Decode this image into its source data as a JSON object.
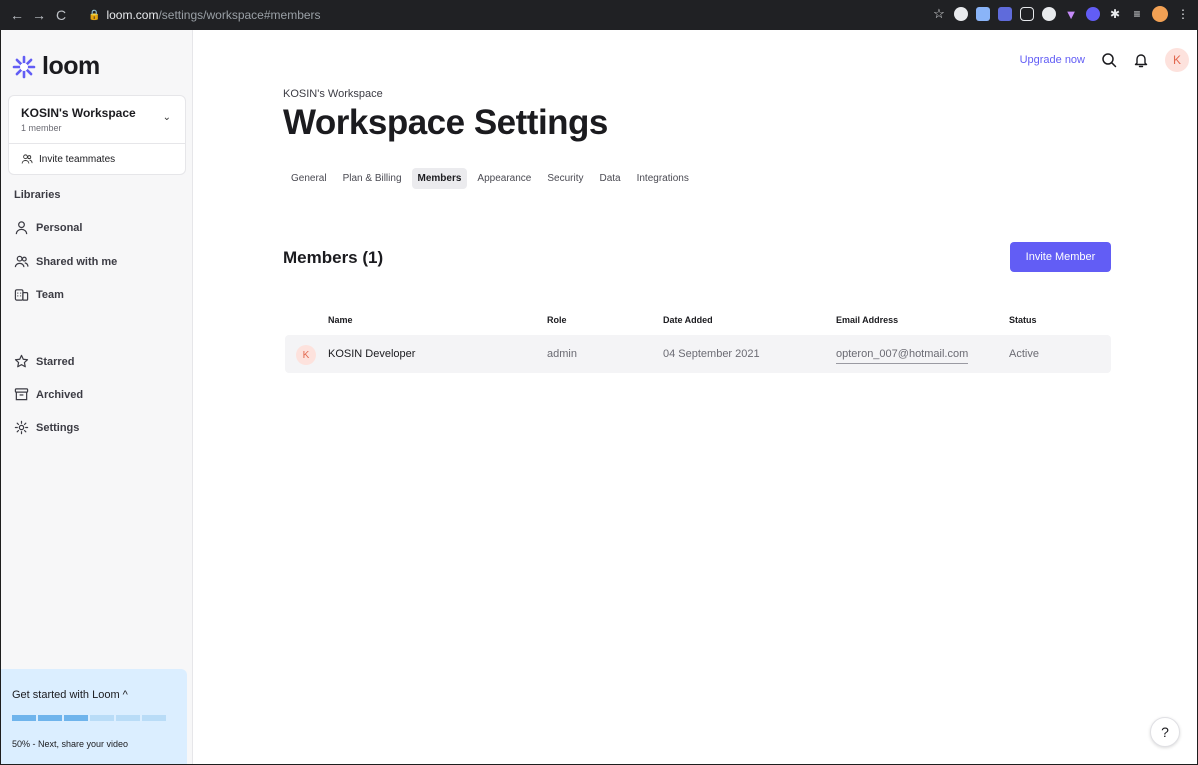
{
  "browser": {
    "url_domain": "loom.com",
    "url_path": "/settings/workspace#members"
  },
  "app": {
    "logo_text": "loom",
    "brand_color": "#625df5"
  },
  "sidebar": {
    "workspace_name": "KOSIN's Workspace",
    "workspace_members": "1 member",
    "invite_teammates": "Invite teammates",
    "libraries_label": "Libraries",
    "items": [
      {
        "label": "Personal",
        "icon": "person-icon"
      },
      {
        "label": "Shared with me",
        "icon": "people-icon"
      },
      {
        "label": "Team",
        "icon": "building-icon"
      },
      {
        "label": "Starred",
        "icon": "star-icon"
      },
      {
        "label": "Archived",
        "icon": "archive-icon"
      },
      {
        "label": "Settings",
        "icon": "gear-icon"
      }
    ],
    "get_started": {
      "title": "Get started with Loom",
      "progress_percent": 50,
      "note": "50% - Next, share your video"
    }
  },
  "header": {
    "upgrade": "Upgrade now",
    "avatar_initial": "K"
  },
  "main": {
    "breadcrumb": "KOSIN's Workspace",
    "title": "Workspace Settings",
    "tabs": [
      {
        "label": "General"
      },
      {
        "label": "Plan & Billing"
      },
      {
        "label": "Members",
        "active": true
      },
      {
        "label": "Appearance"
      },
      {
        "label": "Security"
      },
      {
        "label": "Data"
      },
      {
        "label": "Integrations"
      }
    ],
    "members_heading": "Members (1)",
    "invite_button": "Invite Member",
    "columns": [
      "Name",
      "Role",
      "Date Added",
      "Email Address",
      "Status"
    ],
    "rows": [
      {
        "initial": "K",
        "name": "KOSIN Developer",
        "role": "admin",
        "date_added": "04 September 2021",
        "email": "opteron_007@hotmail.com",
        "status": "Active"
      }
    ]
  },
  "help_button": "?"
}
